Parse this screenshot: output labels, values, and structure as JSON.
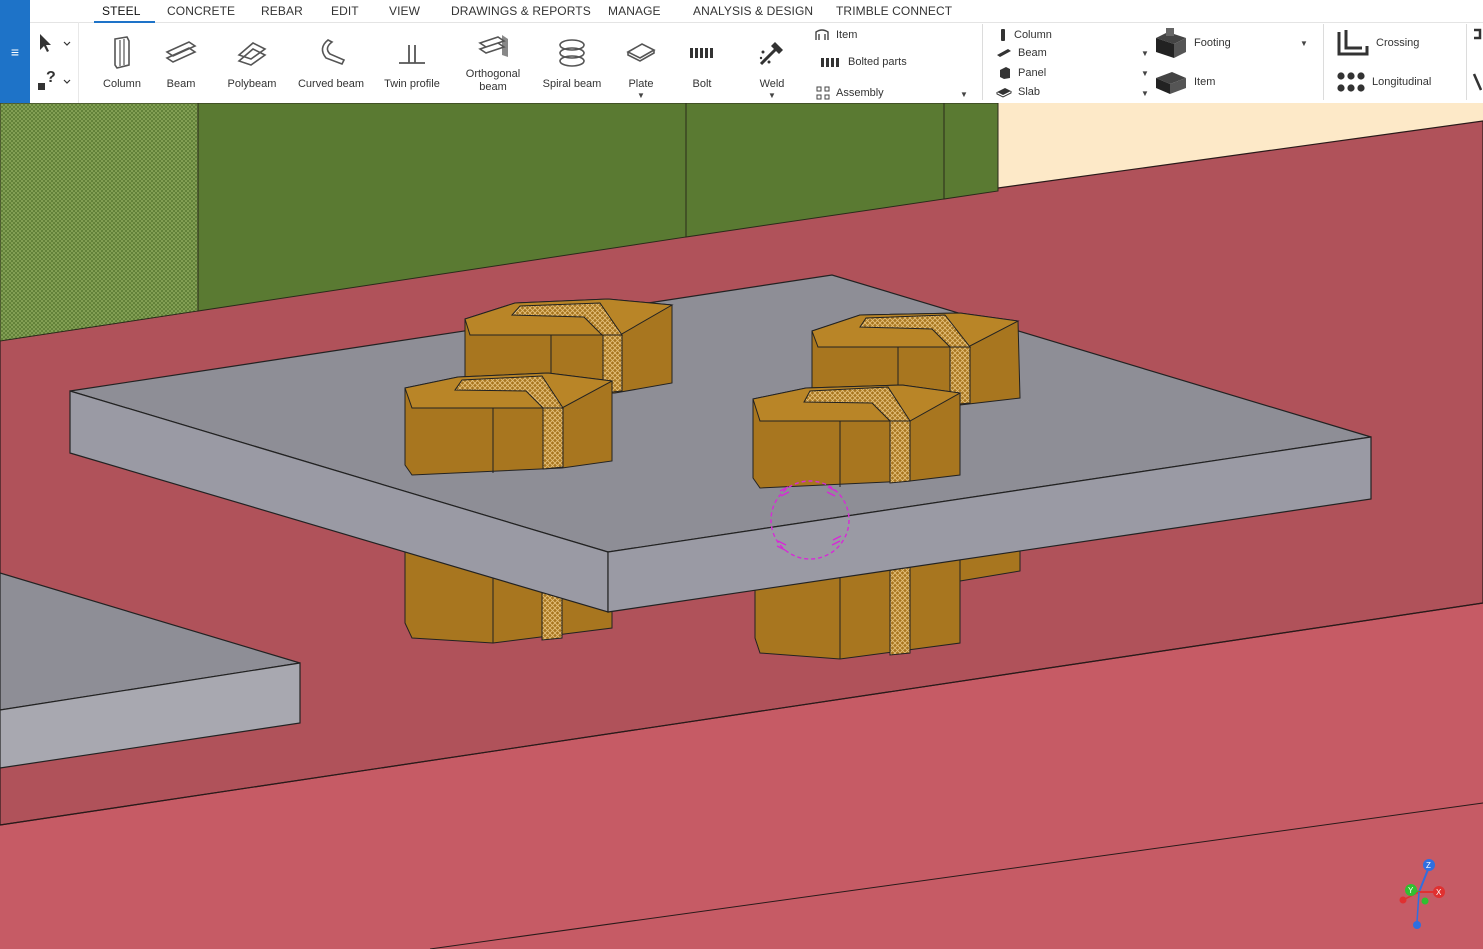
{
  "app": {
    "menu_icon": "hamburger-icon",
    "accent": "#1e73c8"
  },
  "tabs": [
    {
      "label": "STEEL",
      "active": true
    },
    {
      "label": "CONCRETE"
    },
    {
      "label": "REBAR"
    },
    {
      "label": "EDIT"
    },
    {
      "label": "VIEW"
    },
    {
      "label": "DRAWINGS & REPORTS"
    },
    {
      "label": "MANAGE"
    },
    {
      "label": "ANALYSIS & DESIGN"
    },
    {
      "label": "TRIMBLE CONNECT"
    }
  ],
  "steel_tools": {
    "column": "Column",
    "beam": "Beam",
    "polybeam": "Polybeam",
    "curved_beam": "Curved beam",
    "twin_profile": "Twin profile",
    "orthogonal_beam_1": "Orthogonal",
    "orthogonal_beam_2": "beam",
    "spiral_beam": "Spiral beam",
    "plate": "Plate",
    "bolt": "Bolt",
    "weld": "Weld"
  },
  "part_group": {
    "item": "Item",
    "bolted_parts": "Bolted parts",
    "assembly": "Assembly"
  },
  "concrete_group": {
    "column": "Column",
    "beam": "Beam",
    "panel": "Panel",
    "slab": "Slab",
    "footing": "Footing",
    "item": "Item"
  },
  "rebar_group": {
    "crossing": "Crossing",
    "longitudinal": "Longitudinal"
  },
  "colors": {
    "viewport_bg": "#c65b65",
    "beam_top": "#b0525a",
    "green_wall": "#5a7a32",
    "plate_top": "#8e8e96",
    "plate_side": "#9a9aa4",
    "bolt": "#a8761f",
    "cream": "#fde9c8",
    "snap_marker": "#d62ad6"
  },
  "axis_labels": {
    "z": "Z",
    "y": "Y",
    "x": "X"
  }
}
